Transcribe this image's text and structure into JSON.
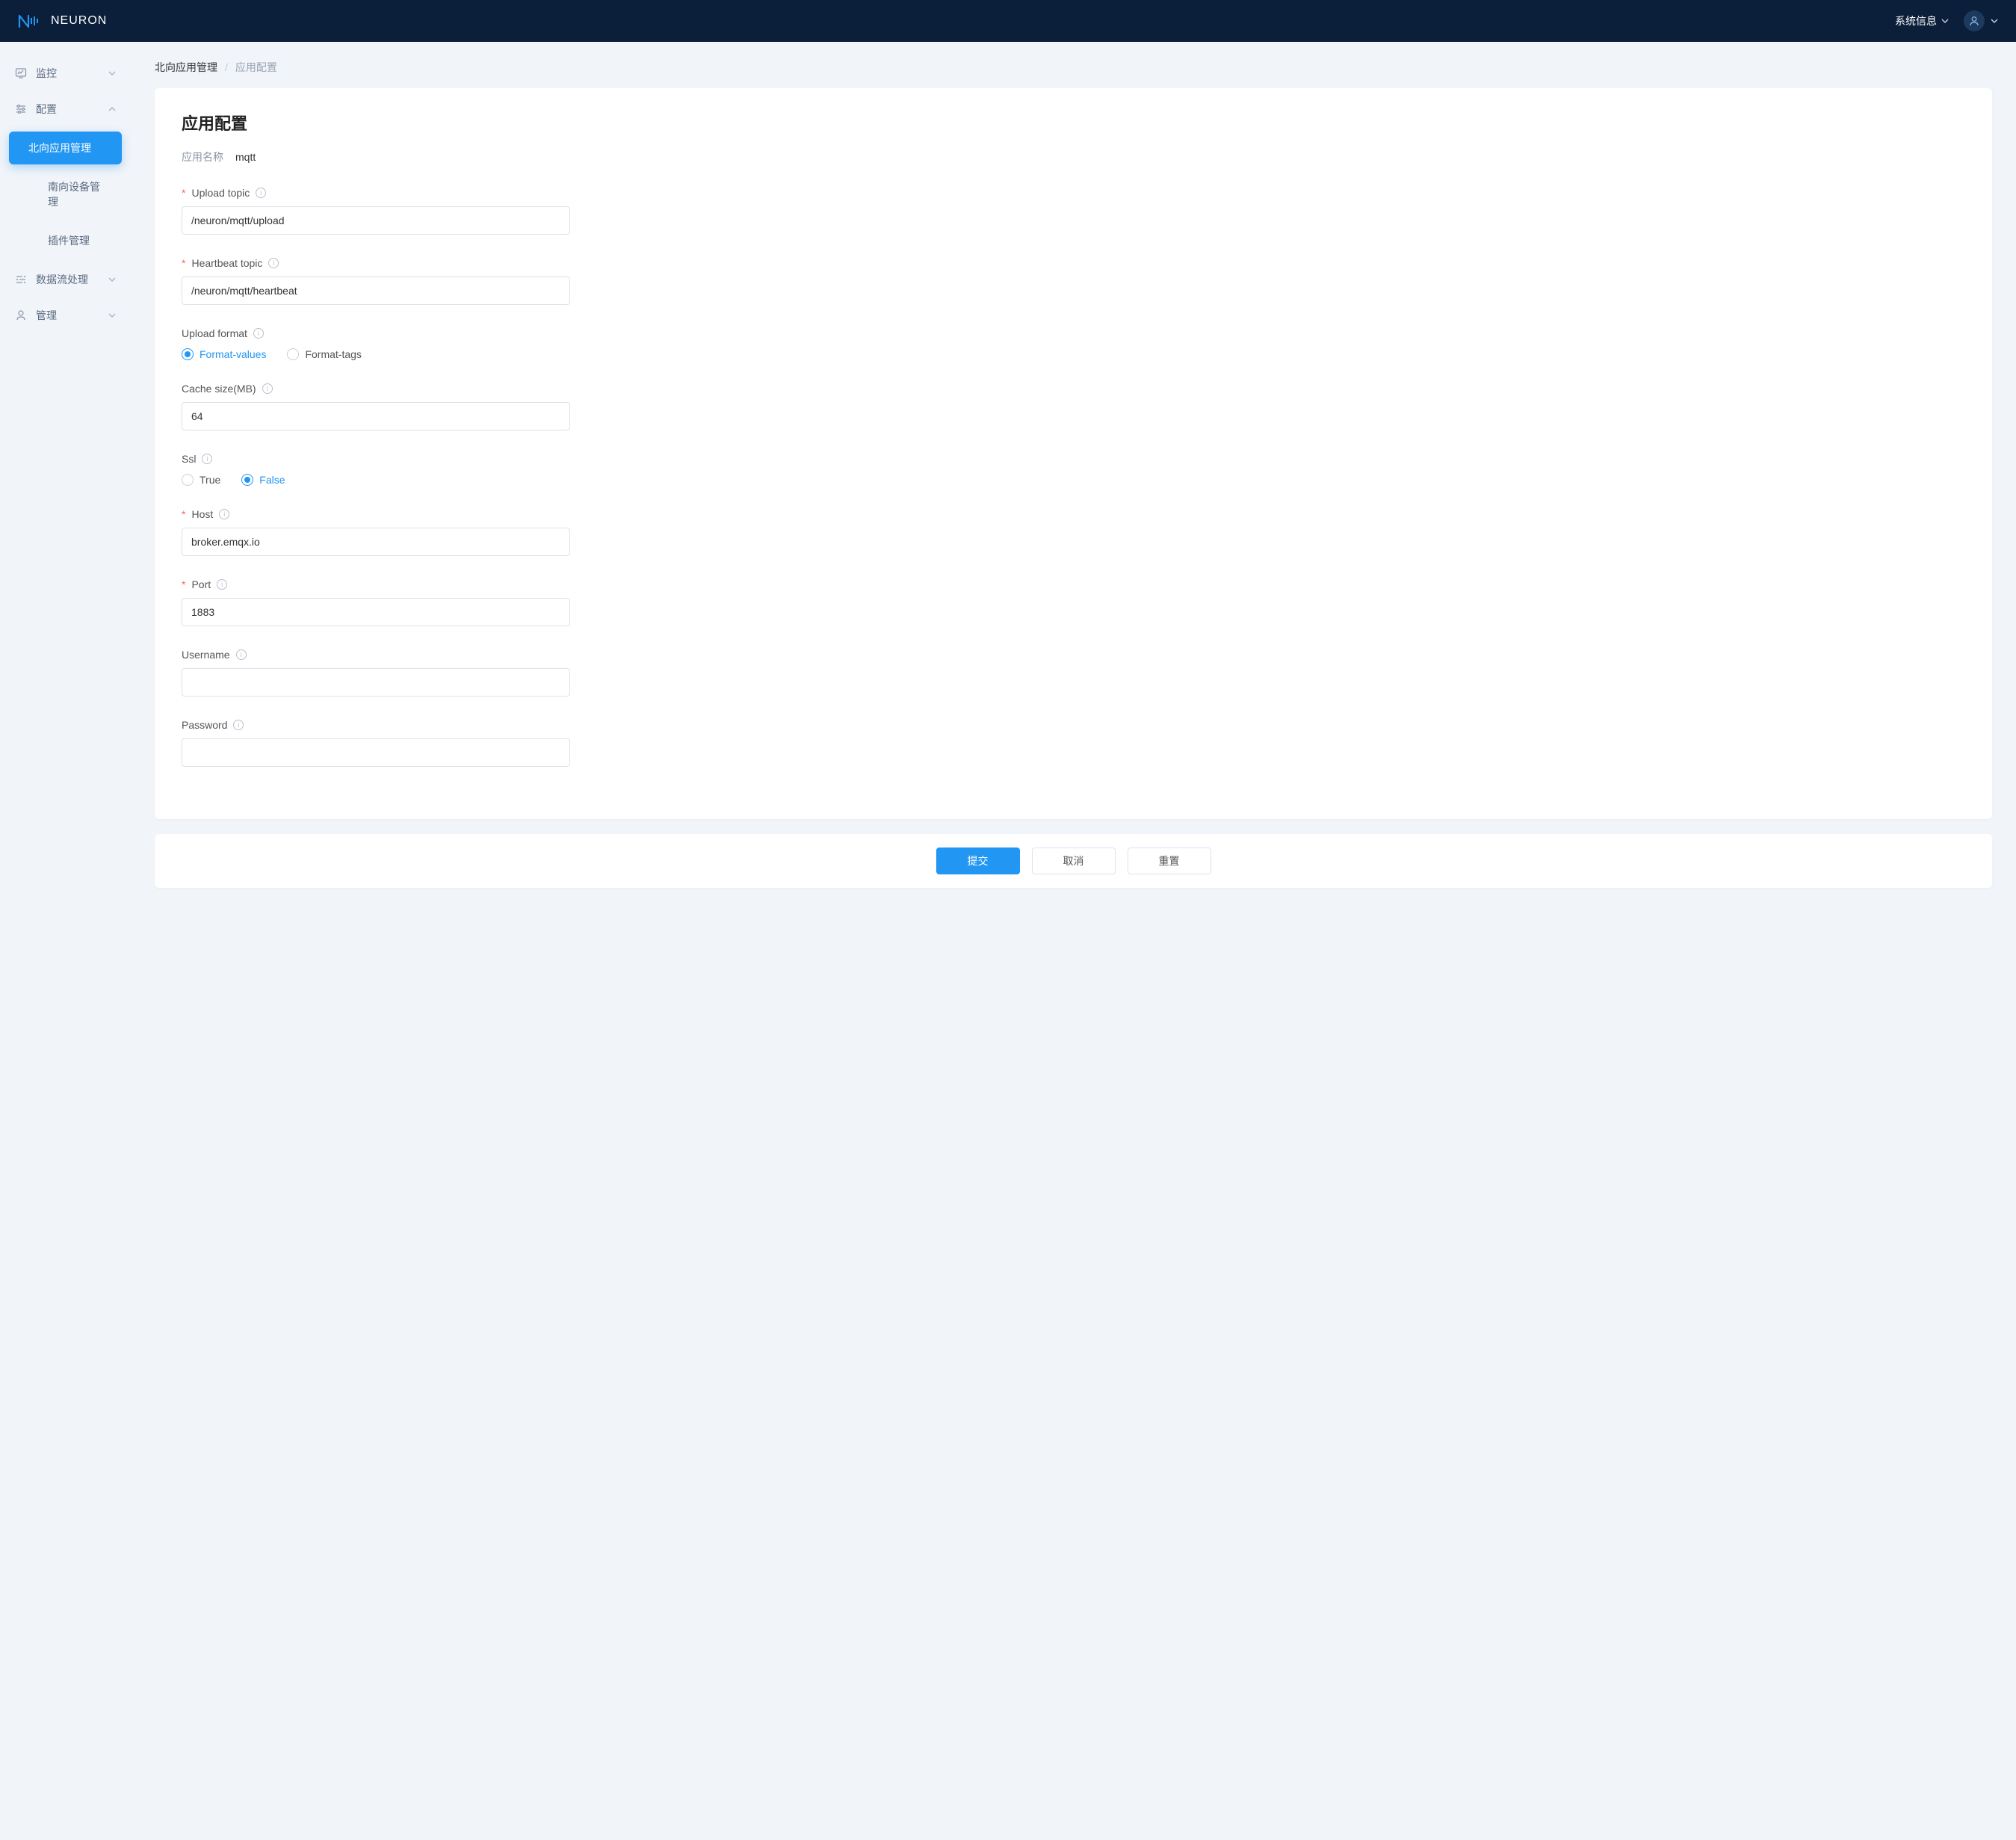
{
  "header": {
    "brand": "NEURON",
    "sysInfo": "系统信息"
  },
  "sidebar": {
    "monitor": {
      "label": "监控"
    },
    "config": {
      "label": "配置",
      "items": [
        {
          "label": "北向应用管理",
          "active": true
        },
        {
          "label": "南向设备管理"
        },
        {
          "label": "插件管理"
        }
      ]
    },
    "dataStream": {
      "label": "数据流处理"
    },
    "admin": {
      "label": "管理"
    }
  },
  "breadcrumb": {
    "parent": "北向应用管理",
    "current": "应用配置"
  },
  "page": {
    "title": "应用配置",
    "appNameLabel": "应用名称",
    "appNameValue": "mqtt"
  },
  "form": {
    "uploadTopic": {
      "label": "Upload topic",
      "value": "/neuron/mqtt/upload",
      "required": true
    },
    "heartbeatTopic": {
      "label": "Heartbeat topic",
      "value": "/neuron/mqtt/heartbeat",
      "required": true
    },
    "uploadFormat": {
      "label": "Upload format",
      "options": [
        {
          "label": "Format-values",
          "selected": true
        },
        {
          "label": "Format-tags",
          "selected": false
        }
      ]
    },
    "cacheSize": {
      "label": "Cache size(MB)",
      "value": "64"
    },
    "ssl": {
      "label": "Ssl",
      "options": [
        {
          "label": "True",
          "selected": false
        },
        {
          "label": "False",
          "selected": true
        }
      ]
    },
    "host": {
      "label": "Host",
      "value": "broker.emqx.io",
      "required": true
    },
    "port": {
      "label": "Port",
      "value": "1883",
      "required": true
    },
    "username": {
      "label": "Username",
      "value": ""
    },
    "password": {
      "label": "Password",
      "value": ""
    }
  },
  "buttons": {
    "submit": "提交",
    "cancel": "取消",
    "reset": "重置"
  }
}
